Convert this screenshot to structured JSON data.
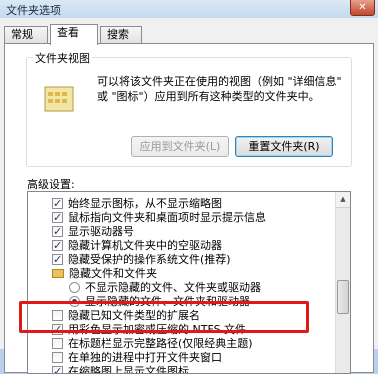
{
  "window": {
    "title": "文件夹选项",
    "close_label": "✕"
  },
  "tabs": [
    {
      "label": "常规"
    },
    {
      "label": "查看"
    },
    {
      "label": "搜索"
    }
  ],
  "folder_views": {
    "title": "文件夹视图",
    "description": "可以将该文件夹正在使用的视图（例如 \"详细信息\" 或 \"图标\"）应用到所有这种类型的文件夹中。",
    "apply_button": "应用到文件夹(L)",
    "reset_button": "重置文件夹(R)"
  },
  "advanced": {
    "label": "高级设置:",
    "items": [
      {
        "type": "checkbox",
        "checked": true,
        "label": "始终显示图标，从不显示缩略图"
      },
      {
        "type": "checkbox",
        "checked": true,
        "label": "鼠标指向文件夹和桌面项时显示提示信息"
      },
      {
        "type": "checkbox",
        "checked": true,
        "label": "显示驱动器号"
      },
      {
        "type": "checkbox",
        "checked": true,
        "label": "隐藏计算机文件夹中的空驱动器"
      },
      {
        "type": "checkbox",
        "checked": true,
        "label": "隐藏受保护的操作系统文件(推荐)"
      },
      {
        "type": "folder",
        "label": "隐藏文件和文件夹"
      },
      {
        "type": "radio",
        "checked": false,
        "label": "不显示隐藏的文件、文件夹或驱动器"
      },
      {
        "type": "radio",
        "checked": true,
        "label": "显示隐藏的文件、文件夹和驱动器"
      },
      {
        "type": "checkbox",
        "checked": false,
        "label": "隐藏已知文件类型的扩展名"
      },
      {
        "type": "checkbox",
        "checked": true,
        "label": "用彩色显示加密或压缩的 NTFS 文件"
      },
      {
        "type": "checkbox",
        "checked": false,
        "label": "在标题栏显示完整路径(仅限经典主题)"
      },
      {
        "type": "checkbox",
        "checked": false,
        "label": "在单独的进程中打开文件夹窗口"
      },
      {
        "type": "checkbox",
        "checked": true,
        "label": "在缩略图上显示文件图标"
      }
    ]
  },
  "colors": {
    "highlight": "#e01818",
    "accent": "#1f3c6e"
  }
}
